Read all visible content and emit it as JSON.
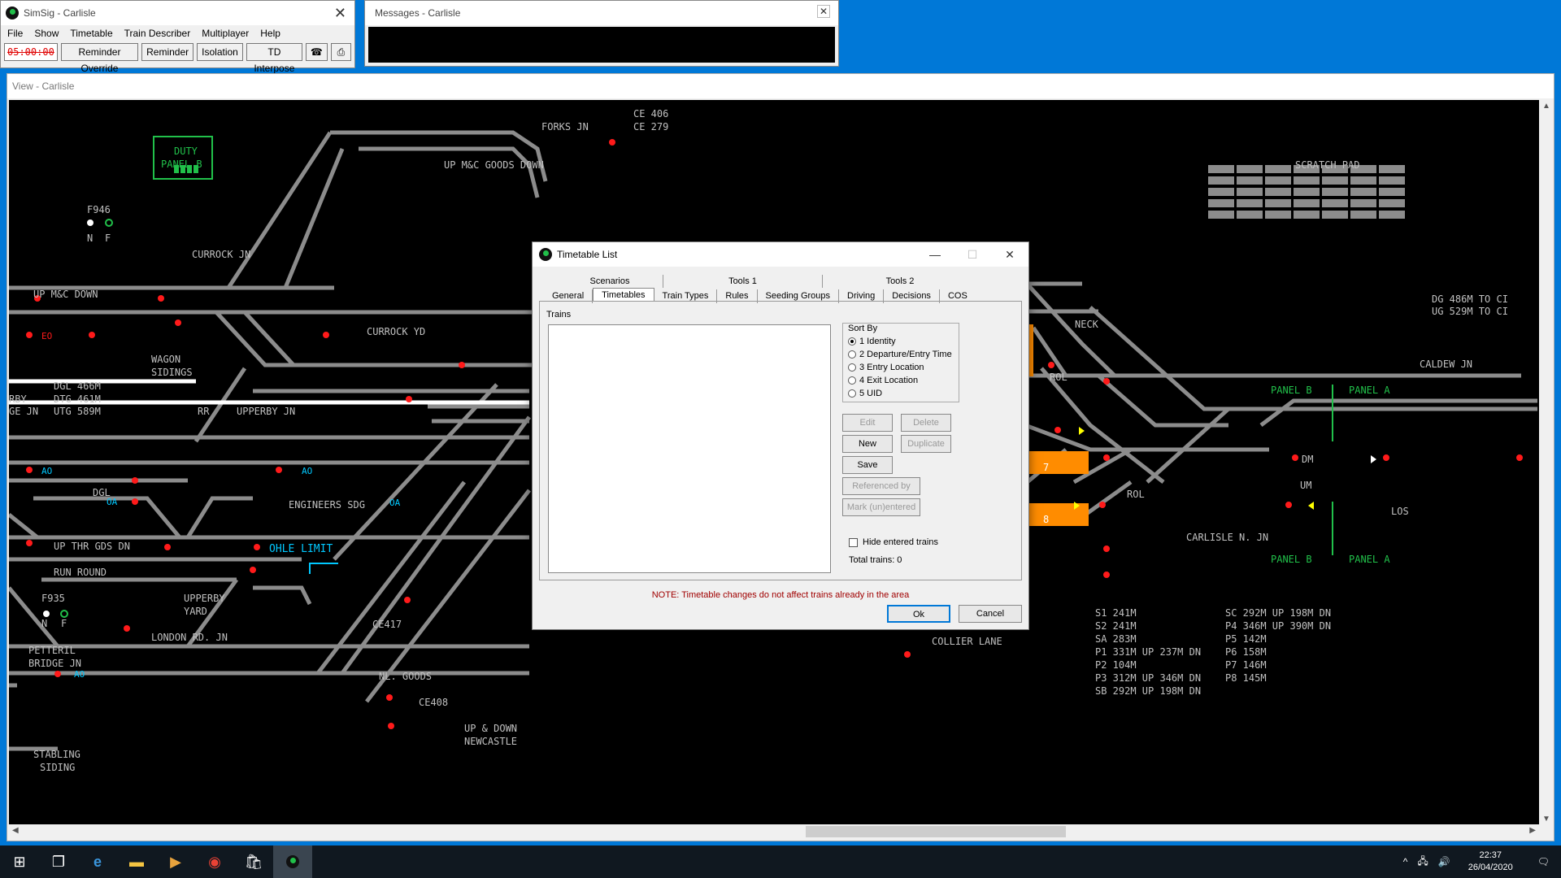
{
  "main_window": {
    "title": "SimSig - Carlisle",
    "menu": [
      "File",
      "Show",
      "Timetable",
      "Train Describer",
      "Multiplayer",
      "Help"
    ],
    "clock": "05:00:00",
    "buttons": [
      "Reminder Override",
      "Reminder",
      "Isolation",
      "TD Interpose"
    ]
  },
  "messages_window": {
    "title": "Messages - Carlisle"
  },
  "view": {
    "title": "View - Carlisle",
    "labels": {
      "forks_jn": "FORKS JN",
      "ce406": "CE 406",
      "ce279": "CE 279",
      "duty_panel_1": "DUTY",
      "duty_panel_2": "PANEL B",
      "up_mc_goods_down": "UP M&C GOODS DOWN",
      "f946": "F946",
      "n": "N",
      "f": "F",
      "currock_jn": "CURROCK JN",
      "up_mc_down": "UP M&C DOWN",
      "eo": "EO",
      "currock_yd": "CURROCK YD",
      "wagon": "WAGON",
      "sidings": "SIDINGS",
      "dgl": "DGL 466M",
      "dtg": "DTG 461M",
      "utg": "UTG 589M",
      "rby": "RBY",
      "ge_jn": "GE JN",
      "rr": "RR",
      "upperby_jn": "UPPERBY JN",
      "ao": "AO",
      "dgl_short": "DGL",
      "oa": "OA",
      "engineers_sdg": "ENGINEERS SDG",
      "up_thr_gds_dn": "UP THR GDS DN",
      "ohle_limit": "OHLE LIMIT",
      "run_round": "RUN ROUND",
      "f935": "F935",
      "upperby": "UPPERBY",
      "yard": "YARD",
      "ce417": "CE417",
      "london_rd_jn": "LONDON RD. JN",
      "petteril": "PETTERIL",
      "bridge_jn": "BRIDGE JN",
      "nl_goods": "NL. GOODS",
      "ce408": "CE408",
      "up_down": "UP & DOWN",
      "newcastle": "NEWCASTLE",
      "stabling": "STABLING",
      "siding": "SIDING",
      "scratch_pad": "SCRATCH PAD",
      "dg486": "DG 486M TO CI",
      "ug529": "UG 529M TO CI",
      "neck": "NECK",
      "rol": "ROL",
      "caldew_jn": "CALDEW JN",
      "panel_b": "PANEL B",
      "panel_a": "PANEL A",
      "dm": "DM",
      "um": "UM",
      "los": "LOS",
      "carlisle_n_jn": "CARLISLE N. JN",
      "collier_lane": "COLLIER LANE",
      "b7": "7",
      "b8": "8"
    },
    "platform_info": [
      [
        "S1 241M",
        "SC 292M UP 198M DN"
      ],
      [
        "S2 241M",
        "P4 346M UP 390M DN"
      ],
      [
        "SA 283M",
        "P5 142M"
      ],
      [
        "P1 331M UP 237M DN",
        "P6 158M"
      ],
      [
        "P2 104M",
        "P7 146M"
      ],
      [
        "P3 312M UP 346M DN",
        "P8 145M"
      ],
      [
        "SB 292M UP 198M DN",
        ""
      ]
    ],
    "colors": {
      "track": "#8c8c8c",
      "signal_red": "#ff1a1a",
      "green": "#21c04a",
      "orange": "#ff8c00",
      "cyan": "#00c8ff"
    }
  },
  "dialog": {
    "title": "Timetable List",
    "tabs_row1": [
      "Scenarios",
      "Tools 1",
      "Tools 2"
    ],
    "tabs_row2": [
      "General",
      "Timetables",
      "Train Types",
      "Rules",
      "Seeding Groups",
      "Driving",
      "Decisions",
      "COS"
    ],
    "trains_label": "Trains",
    "sort_by": "Sort By",
    "sort_options": [
      "1 Identity",
      "2 Departure/Entry Time",
      "3 Entry Location",
      "4 Exit Location",
      "5 UID"
    ],
    "buttons": {
      "edit": "Edit",
      "delete": "Delete",
      "new": "New",
      "duplicate": "Duplicate",
      "save": "Save",
      "referenced_by": "Referenced by",
      "mark": "Mark (un)entered"
    },
    "hide_entered": "Hide entered trains",
    "total_trains": "Total trains: 0",
    "note": "NOTE: Timetable changes do not affect trains already in the area",
    "ok": "Ok",
    "cancel": "Cancel"
  },
  "taskbar": {
    "time": "22:37",
    "date": "26/04/2020"
  }
}
